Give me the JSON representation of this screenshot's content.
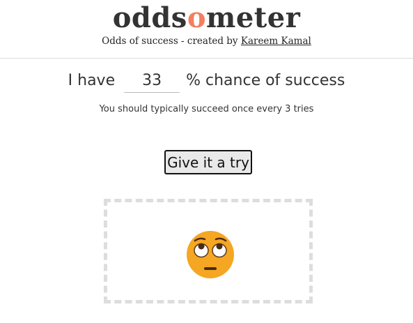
{
  "header": {
    "logo_prefix": "odds",
    "logo_accent": "o",
    "logo_suffix": "meter",
    "tagline_prefix": "Odds of success - created by ",
    "author_link": "Kareem Kamal"
  },
  "main": {
    "chance_prefix": "I have",
    "chance_value": "33",
    "chance_suffix": "% chance of success",
    "hint": "You should typically succeed once every 3 tries",
    "try_button": "Give it a try"
  },
  "result": {
    "icon": "face-with-rolling-eyes-icon"
  },
  "colors": {
    "accent": "#f28060",
    "emoji_face": "#f5a623",
    "box_border": "#dddddd"
  }
}
